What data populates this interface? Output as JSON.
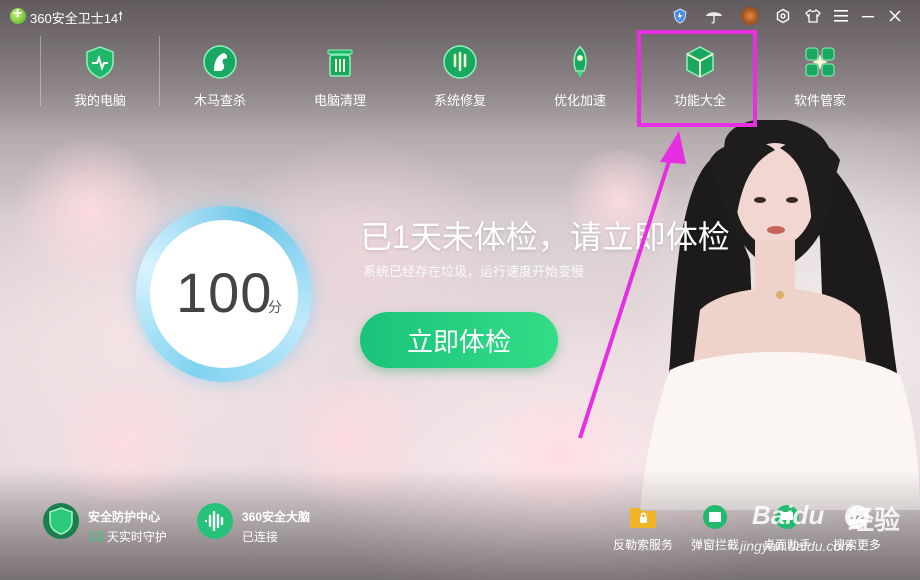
{
  "titlebar": {
    "app_title": "360安全卫士14",
    "icons": [
      "shield-badge-icon",
      "umbrella-icon",
      "avatar-icon",
      "settings-icon",
      "skin-icon",
      "menu-icon",
      "minimize-icon",
      "close-icon"
    ]
  },
  "nav": {
    "items": [
      {
        "label": "我的电脑",
        "icon": "shield-icon"
      },
      {
        "label": "木马查杀",
        "icon": "horse-icon"
      },
      {
        "label": "电脑清理",
        "icon": "trash-icon"
      },
      {
        "label": "系统修复",
        "icon": "repair-icon"
      },
      {
        "label": "优化加速",
        "icon": "rocket-icon"
      },
      {
        "label": "功能大全",
        "icon": "cube-icon"
      },
      {
        "label": "软件管家",
        "icon": "apps-icon"
      }
    ],
    "highlighted": "功能大全",
    "highlight_color": "#e62fe0"
  },
  "score": {
    "value": "100",
    "unit": "分"
  },
  "headline": "已1天未体检，请立即体检",
  "subline": "系统已经存在垃圾，运行速度开始变慢",
  "check_button": "立即体检",
  "bottom_left": [
    {
      "title": "安全防护中心",
      "number": "13",
      "sub": "天实时守护",
      "icon": "shield-status-icon"
    },
    {
      "title": "360安全大脑",
      "sub": "已连接",
      "icon": "brain-wave-icon"
    }
  ],
  "bottom_tools": [
    {
      "label": "反勒索服务",
      "icon": "folder-lock-icon"
    },
    {
      "label": "弹窗拦截",
      "icon": "popup-block-icon"
    },
    {
      "label": "桌面助手",
      "icon": "desktop-assistant-icon"
    },
    {
      "label": "搜索更多",
      "icon": "more-icon"
    }
  ],
  "watermark": {
    "brand": "Baidu",
    "word": "经验",
    "url": "jingyan.baidu.com"
  },
  "colors": {
    "accent_green": "#19c37a",
    "ring_blue": "#7fd2f0"
  }
}
